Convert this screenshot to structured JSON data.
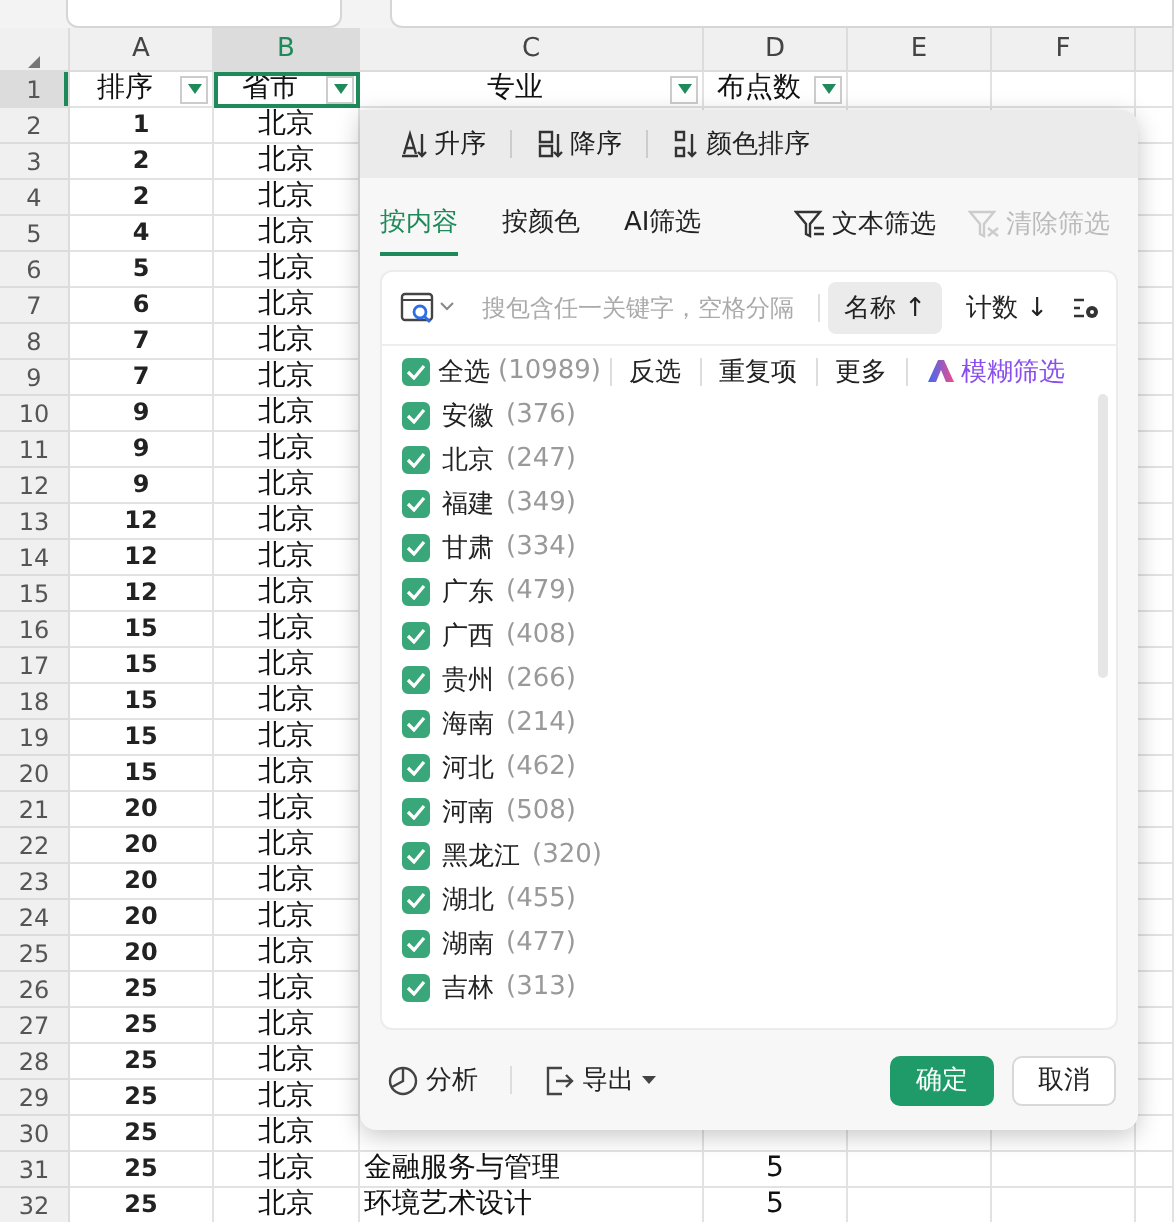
{
  "columns": [
    {
      "label": "A",
      "selected": false
    },
    {
      "label": "B",
      "selected": true
    },
    {
      "label": "C",
      "selected": false
    },
    {
      "label": "D",
      "selected": false
    },
    {
      "label": "E",
      "selected": false
    },
    {
      "label": "F",
      "selected": false
    }
  ],
  "header_row": {
    "number": "1",
    "selected": true,
    "cells": [
      {
        "text": "排序",
        "filter": true,
        "selected": false
      },
      {
        "text": "省市",
        "filter": true,
        "selected": true
      },
      {
        "text": "专业",
        "filter": true,
        "selected": false
      },
      {
        "text": "布点数",
        "filter": true,
        "selected": false
      }
    ]
  },
  "rows": [
    {
      "number": "2",
      "cells": [
        "1",
        "北京"
      ]
    },
    {
      "number": "3",
      "cells": [
        "2",
        "北京"
      ]
    },
    {
      "number": "4",
      "cells": [
        "2",
        "北京"
      ]
    },
    {
      "number": "5",
      "cells": [
        "4",
        "北京"
      ]
    },
    {
      "number": "6",
      "cells": [
        "5",
        "北京"
      ]
    },
    {
      "number": "7",
      "cells": [
        "6",
        "北京"
      ]
    },
    {
      "number": "8",
      "cells": [
        "7",
        "北京"
      ]
    },
    {
      "number": "9",
      "cells": [
        "7",
        "北京"
      ]
    },
    {
      "number": "10",
      "cells": [
        "9",
        "北京"
      ]
    },
    {
      "number": "11",
      "cells": [
        "9",
        "北京"
      ]
    },
    {
      "number": "12",
      "cells": [
        "9",
        "北京"
      ]
    },
    {
      "number": "13",
      "cells": [
        "12",
        "北京"
      ]
    },
    {
      "number": "14",
      "cells": [
        "12",
        "北京"
      ]
    },
    {
      "number": "15",
      "cells": [
        "12",
        "北京"
      ]
    },
    {
      "number": "16",
      "cells": [
        "15",
        "北京"
      ]
    },
    {
      "number": "17",
      "cells": [
        "15",
        "北京"
      ]
    },
    {
      "number": "18",
      "cells": [
        "15",
        "北京"
      ]
    },
    {
      "number": "19",
      "cells": [
        "15",
        "北京"
      ]
    },
    {
      "number": "20",
      "cells": [
        "15",
        "北京"
      ]
    },
    {
      "number": "21",
      "cells": [
        "20",
        "北京"
      ]
    },
    {
      "number": "22",
      "cells": [
        "20",
        "北京"
      ]
    },
    {
      "number": "23",
      "cells": [
        "20",
        "北京"
      ]
    },
    {
      "number": "24",
      "cells": [
        "20",
        "北京"
      ]
    },
    {
      "number": "25",
      "cells": [
        "20",
        "北京"
      ]
    },
    {
      "number": "26",
      "cells": [
        "25",
        "北京"
      ]
    },
    {
      "number": "27",
      "cells": [
        "25",
        "北京"
      ]
    },
    {
      "number": "28",
      "cells": [
        "25",
        "北京"
      ]
    },
    {
      "number": "29",
      "cells": [
        "25",
        "北京"
      ]
    },
    {
      "number": "30",
      "cells": [
        "25",
        "北京"
      ]
    },
    {
      "number": "31",
      "cells": [
        "25",
        "北京",
        "金融服务与管理",
        "5"
      ]
    },
    {
      "number": "32",
      "cells": [
        "25",
        "北京",
        "环境艺术设计",
        "5"
      ]
    }
  ],
  "filter_panel": {
    "sort_actions": [
      "升序",
      "降序",
      "颜色排序"
    ],
    "tabs": [
      {
        "label": "按内容",
        "selected": true
      },
      {
        "label": "按颜色",
        "selected": false
      },
      {
        "label": "AI筛选",
        "selected": false
      }
    ],
    "actions": [
      {
        "label": "文本筛选",
        "disabled": false
      },
      {
        "label": "清除筛选",
        "disabled": true
      }
    ],
    "search": {
      "placeholder": "搜包含任一关键字，空格分隔"
    },
    "sort_buttons": [
      {
        "label": "名称 ↑",
        "selected": true
      },
      {
        "label": "计数 ↓",
        "selected": false
      }
    ],
    "select_all": {
      "label": "全选",
      "count": "(10989)",
      "checked": true
    },
    "quick_links": [
      "反选",
      "重复项",
      "更多"
    ],
    "fuzzy_filter": "模糊筛选",
    "items": [
      {
        "name": "安徽",
        "count": "(376)",
        "checked": true
      },
      {
        "name": "北京",
        "count": "(247)",
        "checked": true
      },
      {
        "name": "福建",
        "count": "(349)",
        "checked": true
      },
      {
        "name": "甘肃",
        "count": "(334)",
        "checked": true
      },
      {
        "name": "广东",
        "count": "(479)",
        "checked": true
      },
      {
        "name": "广西",
        "count": "(408)",
        "checked": true
      },
      {
        "name": "贵州",
        "count": "(266)",
        "checked": true
      },
      {
        "name": "海南",
        "count": "(214)",
        "checked": true
      },
      {
        "name": "河北",
        "count": "(462)",
        "checked": true
      },
      {
        "name": "河南",
        "count": "(508)",
        "checked": true
      },
      {
        "name": "黑龙江",
        "count": "(320)",
        "checked": true
      },
      {
        "name": "湖北",
        "count": "(455)",
        "checked": true
      },
      {
        "name": "湖南",
        "count": "(477)",
        "checked": true
      },
      {
        "name": "吉林",
        "count": "(313)",
        "checked": true
      }
    ],
    "footer": {
      "analyze": "分析",
      "export": "导出",
      "ok": "确定",
      "cancel": "取消"
    }
  }
}
